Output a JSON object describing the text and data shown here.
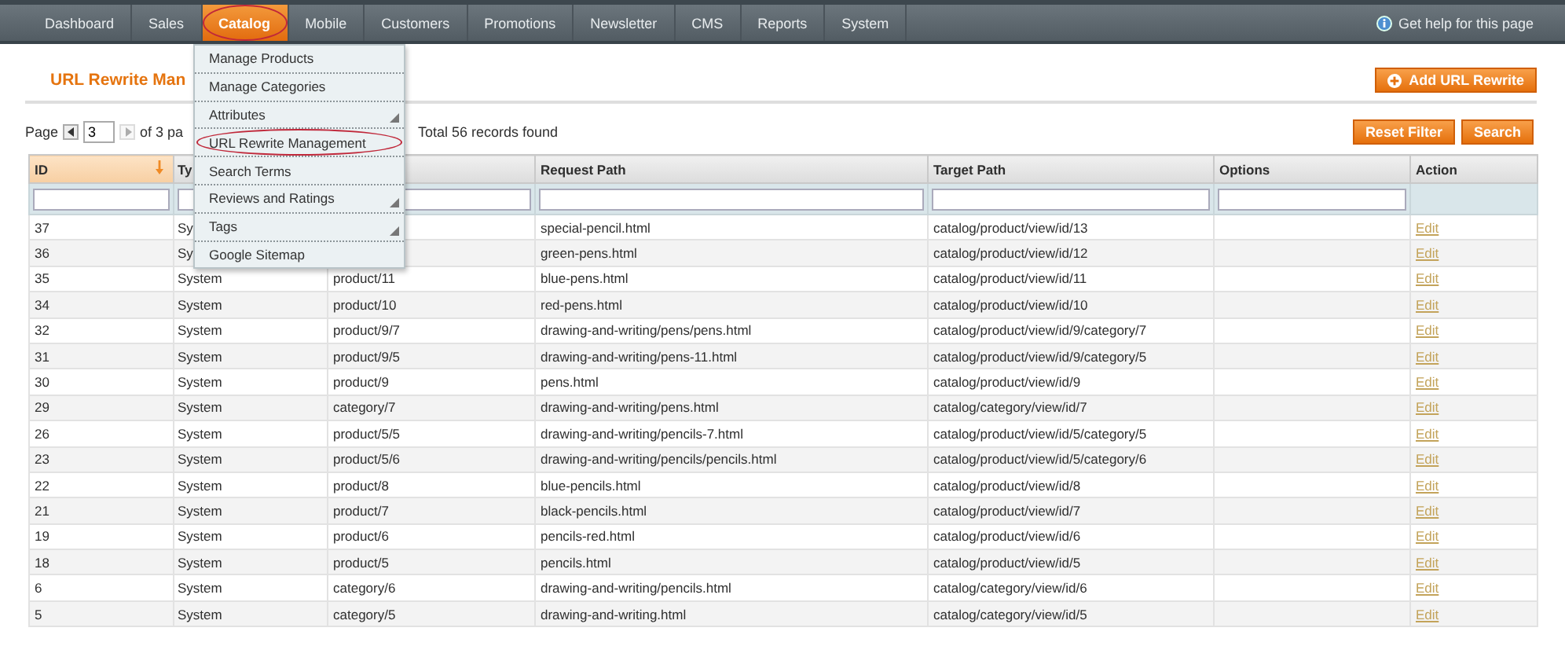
{
  "nav": {
    "items": [
      {
        "label": "Dashboard",
        "selected": false,
        "circled": false
      },
      {
        "label": "Sales",
        "selected": false,
        "circled": false
      },
      {
        "label": "Catalog",
        "selected": true,
        "circled": true
      },
      {
        "label": "Mobile",
        "selected": false,
        "circled": false
      },
      {
        "label": "Customers",
        "selected": false,
        "circled": false
      },
      {
        "label": "Promotions",
        "selected": false,
        "circled": false
      },
      {
        "label": "Newsletter",
        "selected": false,
        "circled": false
      },
      {
        "label": "CMS",
        "selected": false,
        "circled": false
      },
      {
        "label": "Reports",
        "selected": false,
        "circled": false
      },
      {
        "label": "System",
        "selected": false,
        "circled": false
      }
    ],
    "help": "Get help for this page"
  },
  "catalog_menu": {
    "items": [
      {
        "label": "Manage Products",
        "has_submenu": false,
        "circled": false
      },
      {
        "label": "Manage Categories",
        "has_submenu": false,
        "circled": false
      },
      {
        "label": "Attributes",
        "has_submenu": true,
        "circled": false
      },
      {
        "label": "URL Rewrite Management",
        "has_submenu": false,
        "circled": true
      },
      {
        "label": "Search Terms",
        "has_submenu": false,
        "circled": false
      },
      {
        "label": "Reviews and Ratings",
        "has_submenu": true,
        "circled": false
      },
      {
        "label": "Tags",
        "has_submenu": true,
        "circled": false
      },
      {
        "label": "Google Sitemap",
        "has_submenu": false,
        "circled": false
      }
    ]
  },
  "page_title": "URL Rewrite Man",
  "add_button": "Add URL Rewrite",
  "pager": {
    "label": "Page",
    "page": "3",
    "of_pages": "of 3 pa",
    "total": "Total 56 records found"
  },
  "filter_buttons": [
    "Reset Filter",
    "Search"
  ],
  "table": {
    "columns": [
      {
        "label": "ID",
        "sorted": true,
        "filterable": true
      },
      {
        "label": "Ty",
        "sorted": false,
        "filterable": true
      },
      {
        "sorted": false,
        "filterable": true
      },
      {
        "label": "Request Path",
        "sorted": false,
        "filterable": true
      },
      {
        "label": "Target Path",
        "sorted": false,
        "filterable": true
      },
      {
        "label": "Options",
        "sorted": false,
        "filterable": true
      },
      {
        "label": "Action",
        "sorted": false,
        "filterable": false
      }
    ],
    "rows": [
      {
        "id": "37",
        "type": "Sy",
        "request_path": "special-pencil.html",
        "target_path": "catalog/product/view/id/13",
        "action": "Edit"
      },
      {
        "id": "36",
        "type": "Sy",
        "request_path": "green-pens.html",
        "target_path": "catalog/product/view/id/12",
        "action": "Edit"
      },
      {
        "id": "35",
        "type": "System",
        "id_path": "product/11",
        "request_path": "blue-pens.html",
        "target_path": "catalog/product/view/id/11",
        "action": "Edit"
      },
      {
        "id": "34",
        "type": "System",
        "id_path": "product/10",
        "request_path": "red-pens.html",
        "target_path": "catalog/product/view/id/10",
        "action": "Edit"
      },
      {
        "id": "32",
        "type": "System",
        "id_path": "product/9/7",
        "request_path": "drawing-and-writing/pens/pens.html",
        "target_path": "catalog/product/view/id/9/category/7",
        "action": "Edit"
      },
      {
        "id": "31",
        "type": "System",
        "id_path": "product/9/5",
        "request_path": "drawing-and-writing/pens-11.html",
        "target_path": "catalog/product/view/id/9/category/5",
        "action": "Edit"
      },
      {
        "id": "30",
        "type": "System",
        "id_path": "product/9",
        "request_path": "pens.html",
        "target_path": "catalog/product/view/id/9",
        "action": "Edit"
      },
      {
        "id": "29",
        "type": "System",
        "id_path": "category/7",
        "request_path": "drawing-and-writing/pens.html",
        "target_path": "catalog/category/view/id/7",
        "action": "Edit"
      },
      {
        "id": "26",
        "type": "System",
        "id_path": "product/5/5",
        "request_path": "drawing-and-writing/pencils-7.html",
        "target_path": "catalog/product/view/id/5/category/5",
        "action": "Edit"
      },
      {
        "id": "23",
        "type": "System",
        "id_path": "product/5/6",
        "request_path": "drawing-and-writing/pencils/pencils.html",
        "target_path": "catalog/product/view/id/5/category/6",
        "action": "Edit"
      },
      {
        "id": "22",
        "type": "System",
        "id_path": "product/8",
        "request_path": "blue-pencils.html",
        "target_path": "catalog/product/view/id/8",
        "action": "Edit"
      },
      {
        "id": "21",
        "type": "System",
        "id_path": "product/7",
        "request_path": "black-pencils.html",
        "target_path": "catalog/product/view/id/7",
        "action": "Edit"
      },
      {
        "id": "19",
        "type": "System",
        "id_path": "product/6",
        "request_path": "pencils-red.html",
        "target_path": "catalog/product/view/id/6",
        "action": "Edit"
      },
      {
        "id": "18",
        "type": "System",
        "id_path": "product/5",
        "request_path": "pencils.html",
        "target_path": "catalog/product/view/id/5",
        "action": "Edit"
      },
      {
        "id": "6",
        "type": "System",
        "id_path": "category/6",
        "request_path": "drawing-and-writing/pencils.html",
        "target_path": "catalog/category/view/id/6",
        "action": "Edit"
      },
      {
        "id": "5",
        "type": "System",
        "id_path": "category/5",
        "request_path": "drawing-and-writing.html",
        "target_path": "catalog/category/view/id/5",
        "action": "Edit"
      }
    ]
  }
}
